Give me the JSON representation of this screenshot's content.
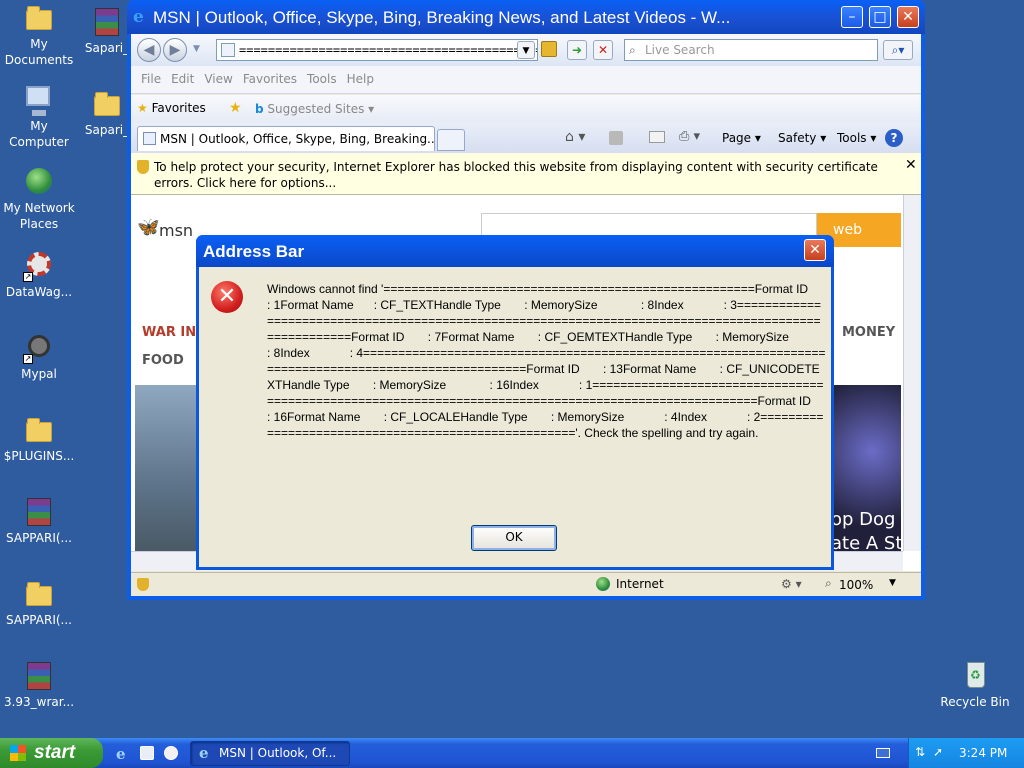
{
  "desktop": {
    "icons": [
      {
        "label": "My Documents",
        "type": "folder"
      },
      {
        "label": "Sapari_",
        "type": "rar"
      },
      {
        "label": "My Computer",
        "type": "computer"
      },
      {
        "label": "Sapari_",
        "type": "folder"
      },
      {
        "label": "My Network Places",
        "type": "network"
      },
      {
        "label": "DataWag...",
        "type": "app"
      },
      {
        "label": "Mypal",
        "type": "app"
      },
      {
        "label": "$PLUGINS...",
        "type": "folder"
      },
      {
        "label": "SAPPARI(...",
        "type": "rar"
      },
      {
        "label": "SAPPARI(...",
        "type": "folder"
      },
      {
        "label": "3.93_wrar...",
        "type": "rar"
      },
      {
        "label": "Recycle Bin",
        "type": "recycle-bin"
      }
    ]
  },
  "ie": {
    "title": "MSN | Outlook, Office, Skype, Bing, Breaking News, and Latest Videos - W...",
    "address": "===============================================",
    "search_placeholder": "Live Search",
    "menu": [
      "File",
      "Edit",
      "View",
      "Favorites",
      "Tools",
      "Help"
    ],
    "favorites_label": "Favorites",
    "suggested_sites": "Suggested Sites",
    "tab_title": "MSN | Outlook, Office, Skype, Bing, Breaking...",
    "commands": {
      "page": "Page",
      "safety": "Safety",
      "tools": "Tools"
    },
    "infobar": "To help protect your security, Internet Explorer has blocked this website from displaying content with security certificate errors. Click here for options...",
    "page": {
      "logo": "msn",
      "search_button": "web searc",
      "nav_left": "WAR IN",
      "nav_food": "FOOD",
      "nav_money": "MONEY",
      "headline_1": "op Dog",
      "headline_2": "ate A Str"
    },
    "status": {
      "zone": "Internet",
      "zoom": "100%"
    }
  },
  "dialog": {
    "title": "Address Bar",
    "message": "Windows cannot find '=====================================================Format ID        : 1Format Name      : CF_TEXTHandle Type       : MemorySize             : 8Index            : 3=======================================================================================================Format ID       : 7Format Name       : CF_OEMTEXTHandle Type       : MemorySize            : 8Index            : 4=======================================================================================================Format ID       : 13Format Name       : CF_UNICODETEXTHandle Type       : MemorySize             : 16Index            : 1=======================================================================================================Format ID       : 16Format Name       : CF_LOCALEHandle Type       : MemorySize            : 4Index            : 2====================================================='. Check the spelling and try again.",
    "ok": "OK"
  },
  "taskbar": {
    "start": "start",
    "task_title": "MSN | Outlook, Of...",
    "clock": "3:24 PM"
  }
}
